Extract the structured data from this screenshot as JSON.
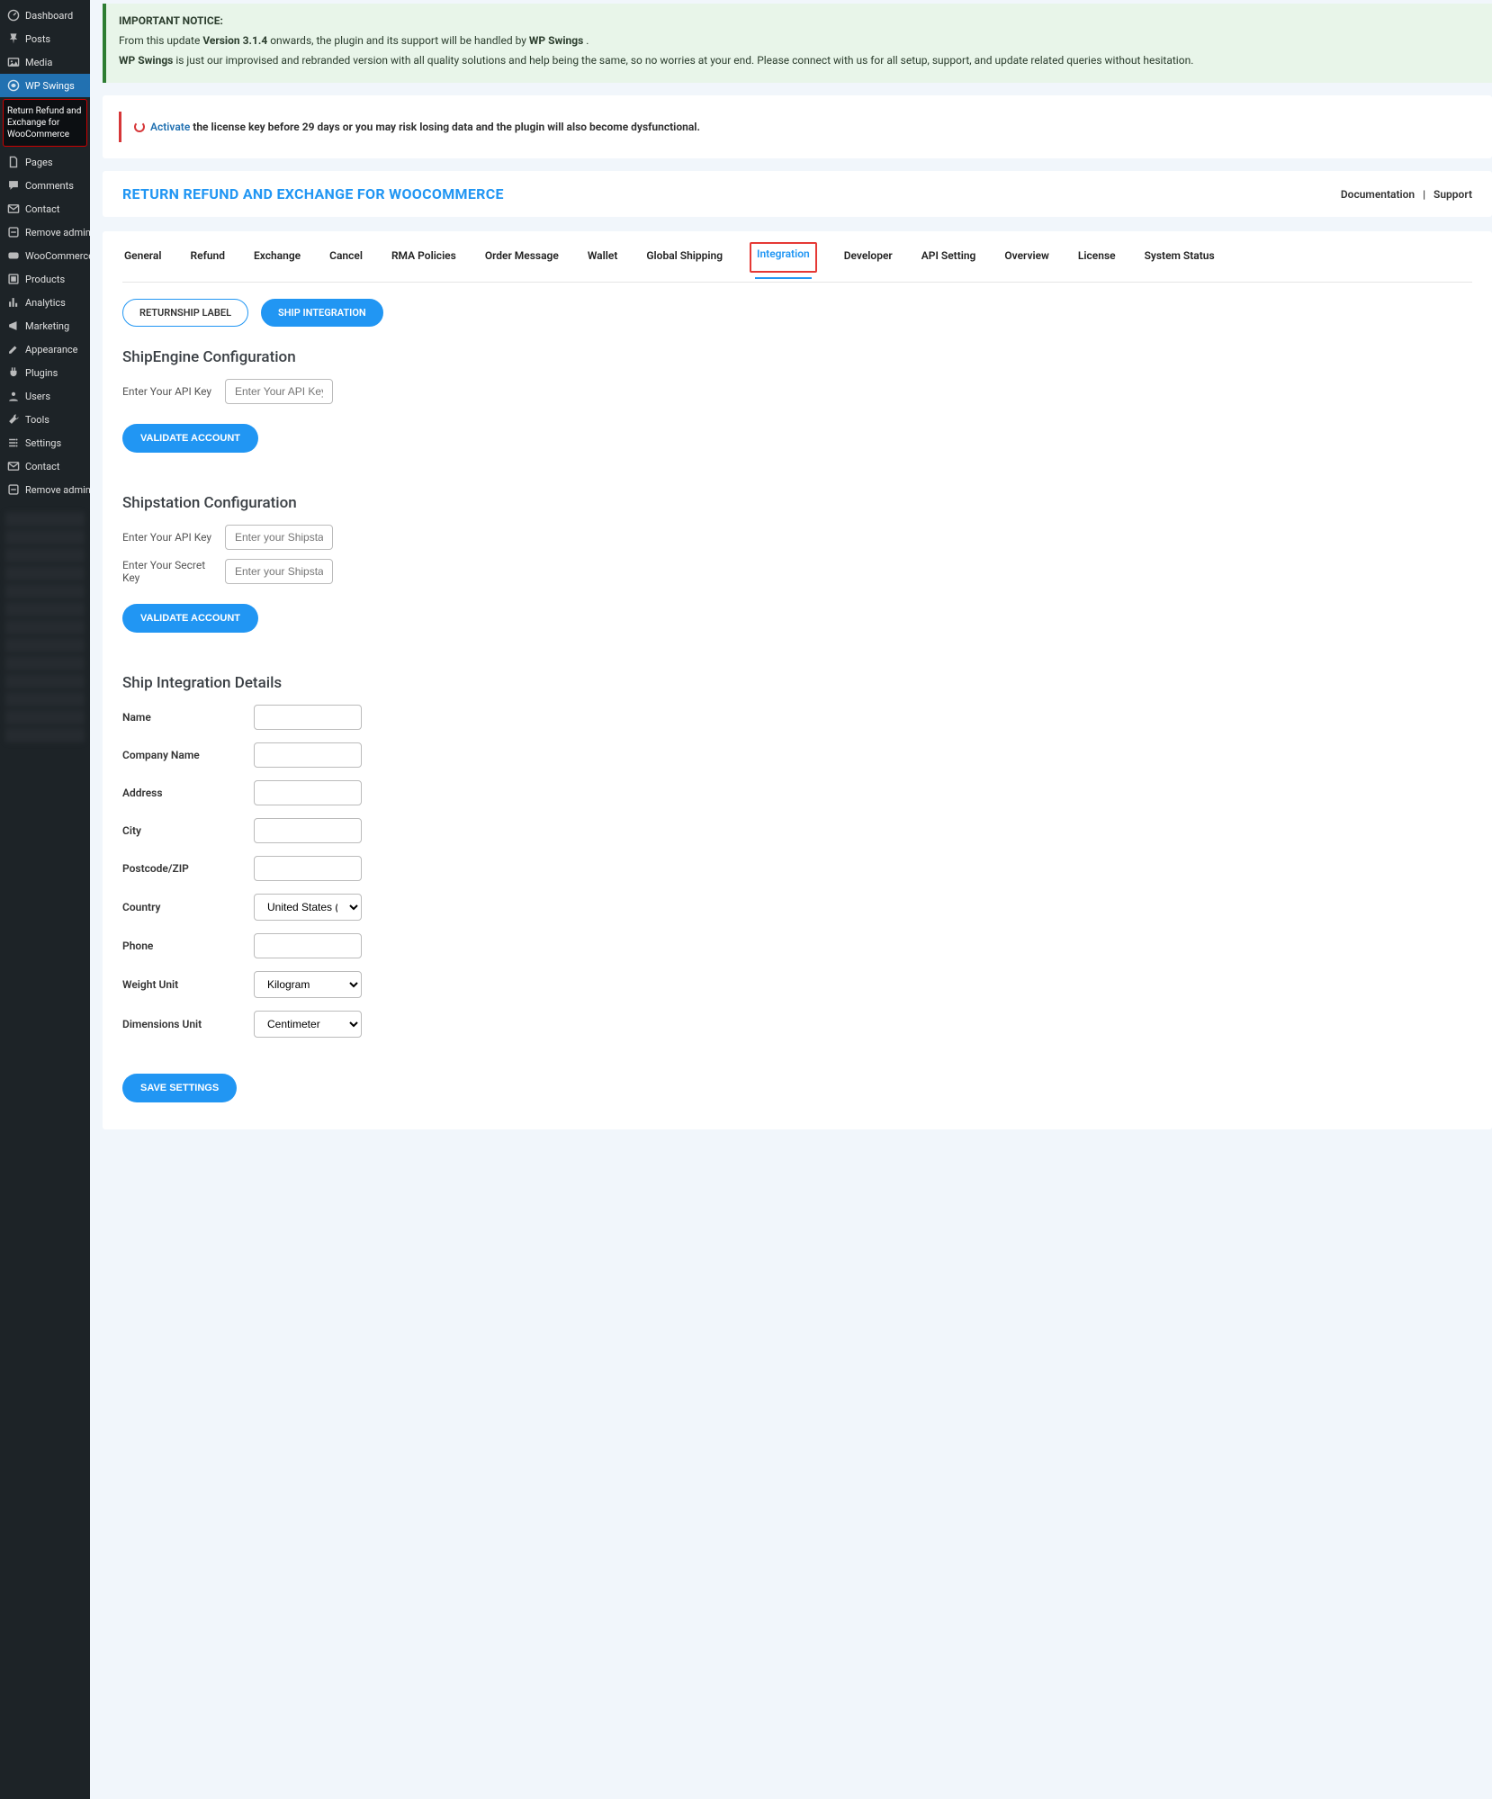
{
  "sidebar": {
    "items": [
      {
        "icon": "dashboard",
        "label": "Dashboard"
      },
      {
        "icon": "pin",
        "label": "Posts"
      },
      {
        "icon": "media",
        "label": "Media"
      },
      {
        "icon": "swings",
        "label": "WP Swings",
        "active": true
      },
      {
        "sub": "Return Refund and Exchange for WooCommerce"
      },
      {
        "icon": "page",
        "label": "Pages"
      },
      {
        "icon": "comment",
        "label": "Comments"
      },
      {
        "icon": "mail",
        "label": "Contact"
      },
      {
        "icon": "remove",
        "label": "Remove admin menus by role"
      },
      {
        "icon": "woo",
        "label": "WooCommerce"
      },
      {
        "icon": "products",
        "label": "Products"
      },
      {
        "icon": "analytics",
        "label": "Analytics"
      },
      {
        "icon": "marketing",
        "label": "Marketing"
      },
      {
        "icon": "appearance",
        "label": "Appearance"
      },
      {
        "icon": "plugins",
        "label": "Plugins"
      },
      {
        "icon": "users",
        "label": "Users"
      },
      {
        "icon": "tools",
        "label": "Tools"
      },
      {
        "icon": "settings",
        "label": "Settings"
      },
      {
        "icon": "mail",
        "label": "Contact"
      },
      {
        "icon": "remove",
        "label": "Remove admin menus by role"
      }
    ]
  },
  "notice": {
    "heading": "IMPORTANT NOTICE:",
    "line1_a": "From this update ",
    "line1_b": "Version 3.1.4",
    "line1_c": " onwards, the plugin and its support will be handled by ",
    "line1_d": "WP Swings",
    "line1_e": ".",
    "line2_a": "WP Swings",
    "line2_b": " is just our improvised and rebranded version with all quality solutions and help being the same, so no worries at your end. Please connect with us for all setup, support, and update related queries without hesitation."
  },
  "license": {
    "link": "Activate",
    "rest": " the license key before 29 days or you may risk losing data and the plugin will also become dysfunctional."
  },
  "header": {
    "title": "RETURN REFUND AND EXCHANGE FOR WOOCOMMERCE",
    "doc": "Documentation",
    "sep": "|",
    "support": "Support"
  },
  "tabs": {
    "row": [
      "General",
      "Refund",
      "Exchange",
      "Cancel",
      "RMA Policies",
      "Order Message",
      "Wallet",
      "Global Shipping",
      "Integration",
      "Developer",
      "API Setting",
      "Overview",
      "License",
      "System Status"
    ],
    "active_index": 8
  },
  "subtabs": {
    "inactive": "RETURNSHIP LABEL",
    "active": "SHIP INTEGRATION"
  },
  "shipengine": {
    "title": "ShipEngine Configuration",
    "api_label": "Enter Your API Key",
    "api_placeholder": "Enter Your API Key",
    "validate": "VALIDATE ACCOUNT"
  },
  "shipstation": {
    "title": "Shipstation Configuration",
    "api_label": "Enter Your API Key",
    "api_placeholder": "Enter your Shipstation Ap",
    "secret_label": "Enter Your Secret Key",
    "secret_placeholder": "Enter your Shipstation Se",
    "validate": "VALIDATE ACCOUNT"
  },
  "details": {
    "title": "Ship Integration Details",
    "fields": [
      {
        "label": "Name",
        "type": "text"
      },
      {
        "label": "Company Name",
        "type": "text"
      },
      {
        "label": "Address",
        "type": "text"
      },
      {
        "label": "City",
        "type": "text"
      },
      {
        "label": "Postcode/ZIP",
        "type": "text"
      },
      {
        "label": "Country",
        "type": "select",
        "value": "United States (US)"
      },
      {
        "label": "Phone",
        "type": "text"
      },
      {
        "label": "Weight Unit",
        "type": "select",
        "value": "Kilogram"
      },
      {
        "label": "Dimensions Unit",
        "type": "select",
        "value": "Centimeter"
      }
    ],
    "save": "SAVE SETTINGS"
  }
}
